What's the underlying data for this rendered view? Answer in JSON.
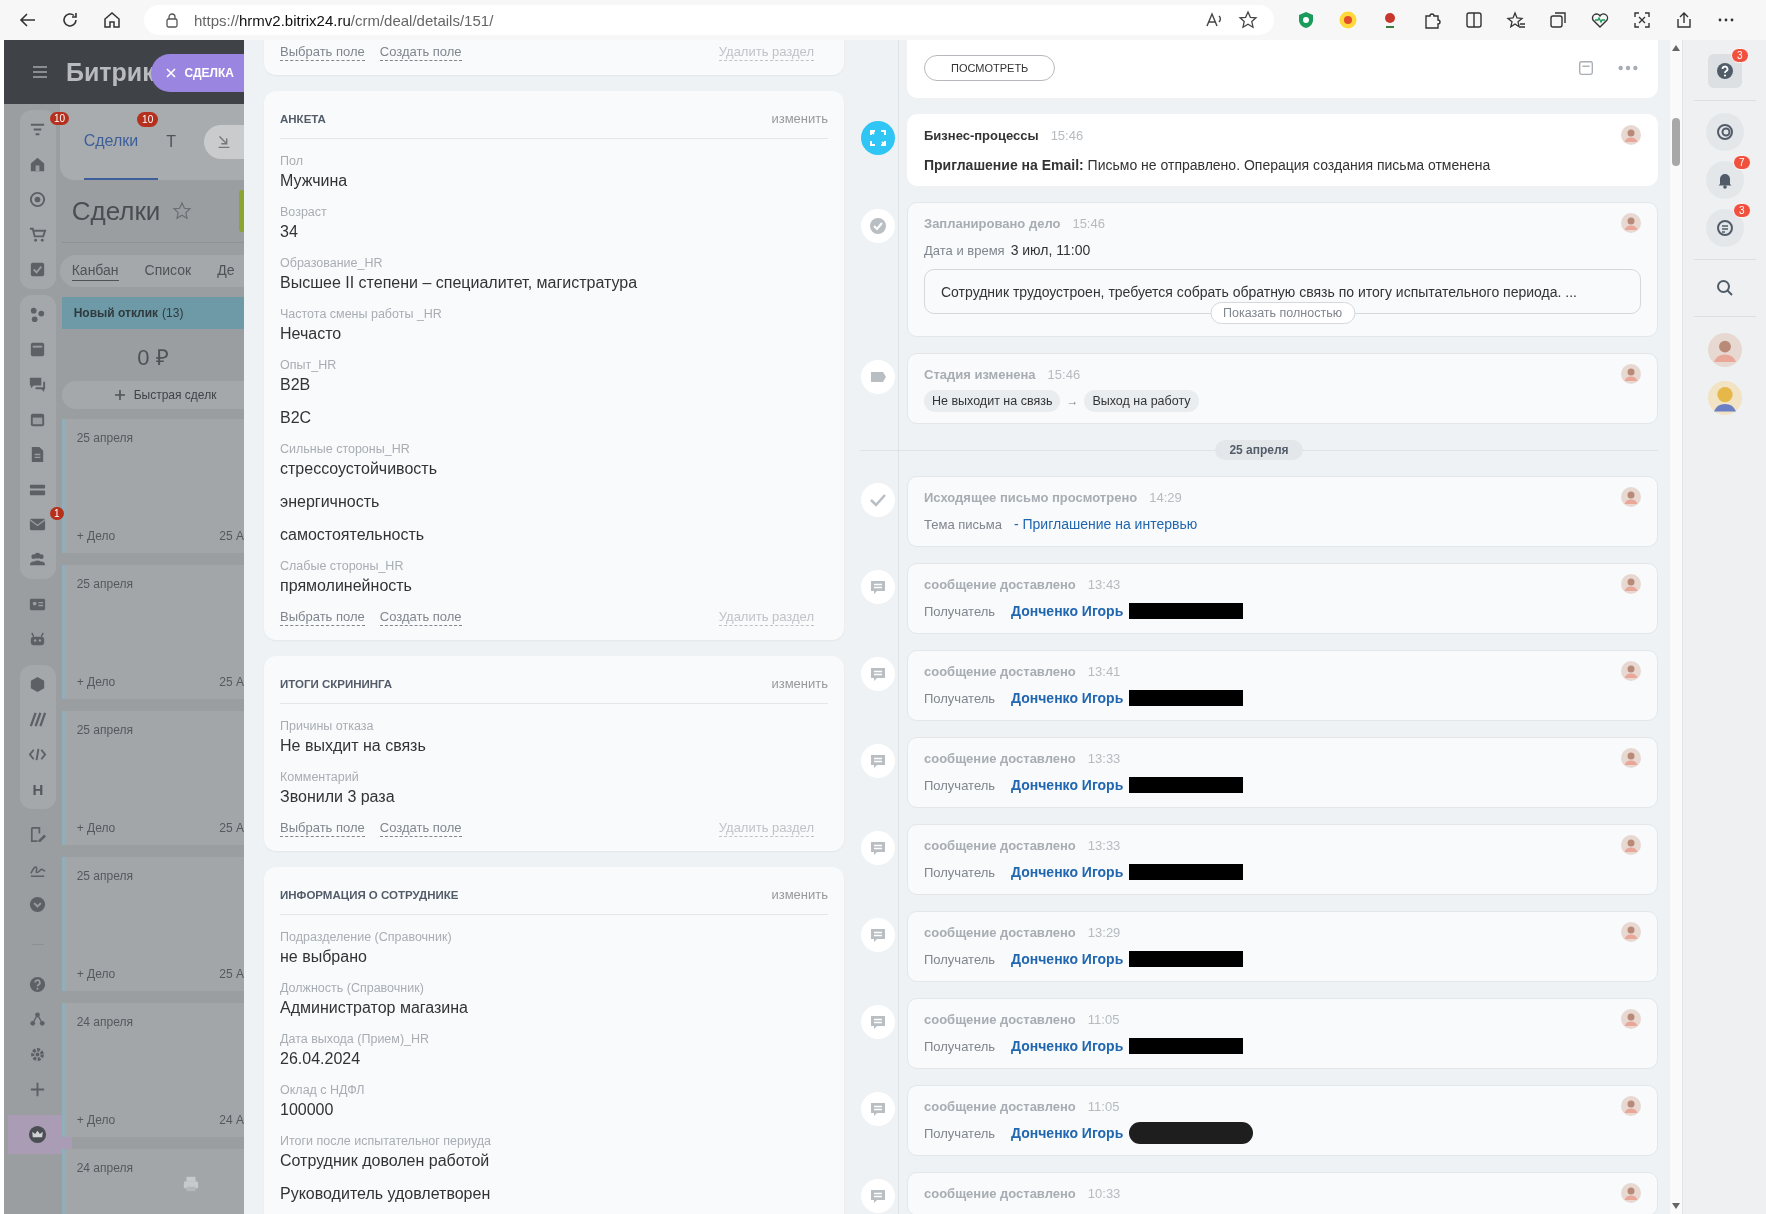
{
  "browser": {
    "url": "https://**hrmv2.bitrix24.ru**/crm/deal/details/151/"
  },
  "background": {
    "logo": "Битрик",
    "close_tab": "СДЕЛКА",
    "menu_badges": {
      "filter": "10",
      "mail": "1"
    },
    "menu_letter": "H",
    "tabs": [
      {
        "label": "Сделки",
        "badge": "10",
        "selected": true
      },
      {
        "label": "Т",
        "selected": false
      }
    ],
    "page_title": "Сделки",
    "views": [
      {
        "label": "Канбан",
        "selected": true
      },
      {
        "label": "Список",
        "selected": false
      },
      {
        "label": "Де",
        "selected": false
      }
    ],
    "column": {
      "title": "Новый отклик",
      "count": "(13)",
      "total": "0 ₽",
      "quick_add": "Быстрая сделк"
    },
    "cards": [
      {
        "date": "25 апреля",
        "action": "+ Дело",
        "due": "25 А"
      },
      {
        "date": "25 апреля",
        "action": "+ Дело",
        "due": "25 А"
      },
      {
        "date": "25 апреля",
        "action": "+ Дело",
        "due": "25 А"
      },
      {
        "date": "25 апреля",
        "action": "+ Дело",
        "due": "25 А"
      },
      {
        "date": "24 апреля",
        "action": "+ Дело",
        "due": "24 А"
      },
      {
        "date": "24 апреля"
      }
    ]
  },
  "form": {
    "sections": [
      {
        "links": {
          "select": "Выбрать поле",
          "create": "Создать поле",
          "delete": "Удалить раздел"
        }
      },
      {
        "title": "АНКЕТА",
        "edit": "изменить",
        "fields": [
          {
            "label": "Пол",
            "values": [
              "Мужчина"
            ]
          },
          {
            "label": "Возраст",
            "values": [
              "34"
            ]
          },
          {
            "label": "Образование_HR",
            "values": [
              "Высшее II степени – специалитет, магистратура"
            ]
          },
          {
            "label": "Частота смены работы _HR",
            "values": [
              "Нечасто"
            ]
          },
          {
            "label": "Опыт_HR",
            "values": [
              "B2B",
              "B2C"
            ]
          },
          {
            "label": "Сильные стороны_HR",
            "values": [
              "стрессоустойчивость",
              "энергичность",
              "самостоятельность"
            ]
          },
          {
            "label": "Слабые стороны_HR",
            "values": [
              "прямолинейность"
            ]
          }
        ],
        "links": {
          "select": "Выбрать поле",
          "create": "Создать поле",
          "delete": "Удалить раздел"
        }
      },
      {
        "title": "ИТОГИ СКРИНИНГА",
        "edit": "изменить",
        "fields": [
          {
            "label": "Причины отказа",
            "values": [
              "Не выхдит на связь"
            ]
          },
          {
            "label": "Комментарий",
            "values": [
              "Звонили 3 раза"
            ]
          }
        ],
        "links": {
          "select": "Выбрать поле",
          "create": "Создать поле",
          "delete": "Удалить раздел"
        }
      },
      {
        "title": "ИНФОРМАЦИЯ О СОТРУДНИКЕ",
        "edit": "изменить",
        "fields": [
          {
            "label": "Подразделение (Справочник)",
            "values": [
              "не выбрано"
            ]
          },
          {
            "label": "Должность (Справочник)",
            "values": [
              "Администратор магазина"
            ]
          },
          {
            "label": "Дата выхода (Прием)_HR",
            "values": [
              "26.04.2024"
            ]
          },
          {
            "label": "Оклад с НДФЛ",
            "values": [
              "100000"
            ]
          },
          {
            "label": "Итоги после испытательног периуда",
            "values": [
              "Сотрудник доволен работой",
              "Руководитель удовлетворен"
            ]
          }
        ]
      }
    ]
  },
  "timeline": [
    {
      "kind": "tail",
      "button": "ПОСМОТРЕТЬ"
    },
    {
      "kind": "bizproc",
      "title": "Бизнес-процессы",
      "time": "15:46",
      "text": "**Приглашение на Email:** Письмо не отправлено. Операция создания письма отменена"
    },
    {
      "kind": "task",
      "title": "Запланировано дело",
      "time": "15:46",
      "label": "Дата и время",
      "value": "3 июл, 11:00",
      "note": "Сотрудник трудоустроен, требуется собрать обратную связь по итогу испытательного периода. ...",
      "more": "Показать полностью"
    },
    {
      "kind": "stage",
      "title": "Стадия изменена",
      "time": "15:46",
      "from": "Не выходит на связь",
      "arrow": "→",
      "to": "Выход на работу"
    },
    {
      "kind": "divider",
      "date": "25 апреля"
    },
    {
      "kind": "email",
      "title": "Исходящее письмо просмотрено",
      "time": "14:29",
      "label": "Тема письма",
      "link": "- Приглашение на интервью"
    },
    {
      "kind": "sms",
      "title": "сообщение доставлено",
      "time": "13:43",
      "label": "Получатель",
      "name": "Донченко Игорь",
      "redacted": true,
      "rounded": false
    },
    {
      "kind": "sms",
      "title": "сообщение доставлено",
      "time": "13:41",
      "label": "Получатель",
      "name": "Донченко Игорь",
      "redacted": true,
      "rounded": false
    },
    {
      "kind": "sms",
      "title": "сообщение доставлено",
      "time": "13:33",
      "label": "Получатель",
      "name": "Донченко Игорь",
      "redacted": true,
      "rounded": false
    },
    {
      "kind": "sms",
      "title": "сообщение доставлено",
      "time": "13:33",
      "label": "Получатель",
      "name": "Донченко Игорь",
      "redacted": true,
      "rounded": false
    },
    {
      "kind": "sms",
      "title": "сообщение доставлено",
      "time": "13:29",
      "label": "Получатель",
      "name": "Донченко Игорь",
      "redacted": true,
      "rounded": false
    },
    {
      "kind": "sms",
      "title": "сообщение доставлено",
      "time": "11:05",
      "label": "Получатель",
      "name": "Донченко Игорь",
      "redacted": true,
      "rounded": false
    },
    {
      "kind": "sms",
      "title": "сообщение доставлено",
      "time": "11:05",
      "label": "Получатель",
      "name": "Донченко Игорь",
      "redacted": true,
      "rounded": true
    },
    {
      "kind": "sms",
      "title": "сообщение доставлено",
      "time": "10:33"
    }
  ],
  "right_bar": {
    "help_badge": "3",
    "bell_badge": "7",
    "chat_badge": "3"
  }
}
